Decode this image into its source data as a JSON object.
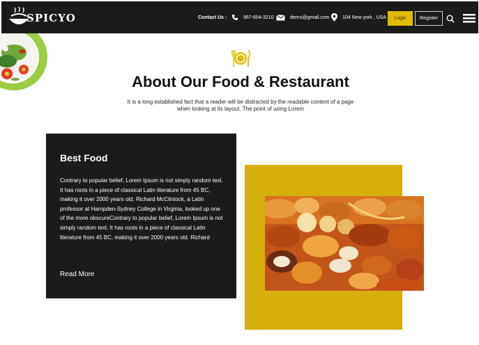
{
  "header": {
    "brand": "SPICYO",
    "contact_label": "Contact Us :",
    "phone": "987-654-3210",
    "email": "demo@gmail.com",
    "location": "104 New york , USA",
    "login_label": "Login",
    "register_label": "Register",
    "icons": [
      "logo-icon",
      "phone-icon",
      "mail-icon",
      "location-pin-icon",
      "search-icon",
      "menu-icon"
    ]
  },
  "about": {
    "icon": "fork-knife-plate-icon",
    "title": "About Our Food & Restaurant",
    "intro": "It is a long established fact that a reader will be distracted by the readable content of a page when looking at its layout. The point of using Lorem"
  },
  "card": {
    "title": "Best Food",
    "body": "Contrary to popular belief, Lorem Ipsum is not simply random text. It has roots in a piece of classical Latin literature from 45 BC, making it over 2000 years old. Richard McClintock, a Latin professor at Hampden-Sydney College in Virginia, looked up one of the more obscureContrary to popular belief, Lorem Ipsum is not simply random text. It has roots in a piece of classical Latin literature from 45 BC, making it over 2000 years old. Richard",
    "read_more": "Read More"
  },
  "colors": {
    "header_bg": "#1b1b1b",
    "accent_yellow": "#e0bd00",
    "block_yellow": "#d6af0c",
    "card_bg": "#1b1b1b"
  }
}
